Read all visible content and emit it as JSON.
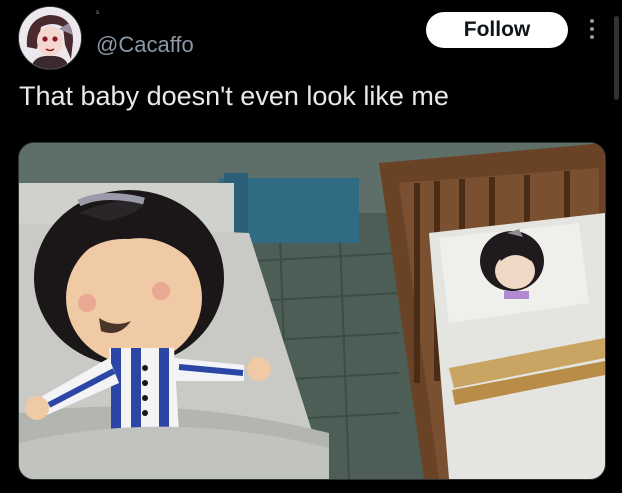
{
  "post": {
    "author_name": "ˢ",
    "handle": "@Cacaffo",
    "follow_label": "Follow",
    "text": "That baby doesn't even look like me"
  },
  "colors": {
    "background": "#000000",
    "text": "#e7e9ea",
    "secondary_text": "#8b98a5",
    "button_bg": "#ffffff",
    "button_text": "#0f1419"
  },
  "icons": [
    "more-options-icon"
  ],
  "media": {
    "description_kind": "image",
    "alt": ""
  }
}
